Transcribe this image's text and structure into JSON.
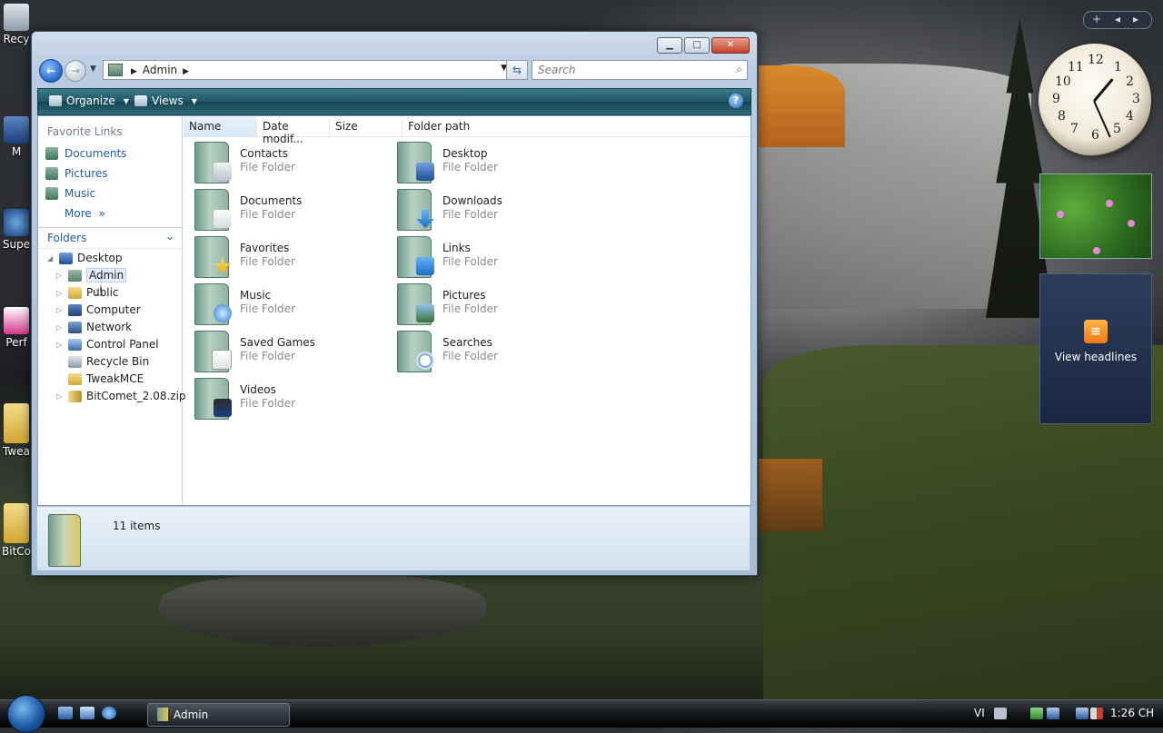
{
  "window": {
    "address_crumb": "Admin",
    "search_placeholder": "Search",
    "toolbar": {
      "organize": "Organize",
      "views": "Views"
    }
  },
  "navigation_pane": {
    "favorite_links_header": "Favorite Links",
    "favorites": [
      "Documents",
      "Pictures",
      "Music"
    ],
    "more_label": "More",
    "folders_header": "Folders",
    "tree": [
      {
        "label": "Desktop",
        "expanded": true
      },
      {
        "label": "Admin",
        "selected": true
      },
      {
        "label": "Public"
      },
      {
        "label": "Computer"
      },
      {
        "label": "Network"
      },
      {
        "label": "Control Panel"
      },
      {
        "label": "Recycle Bin"
      },
      {
        "label": "TweakMCE"
      },
      {
        "label": "BitComet_2.08.zip"
      }
    ]
  },
  "columns": [
    "Name",
    "Date modif...",
    "Size",
    "Folder path"
  ],
  "items": [
    {
      "name": "Contacts",
      "type": "File Folder",
      "icon": "contacts-folder-icon"
    },
    {
      "name": "Desktop",
      "type": "File Folder",
      "icon": "desktop-folder-icon"
    },
    {
      "name": "Documents",
      "type": "File Folder",
      "icon": "documents-folder-icon"
    },
    {
      "name": "Downloads",
      "type": "File Folder",
      "icon": "downloads-folder-icon"
    },
    {
      "name": "Favorites",
      "type": "File Folder",
      "icon": "favorites-folder-icon"
    },
    {
      "name": "Links",
      "type": "File Folder",
      "icon": "links-folder-icon"
    },
    {
      "name": "Music",
      "type": "File Folder",
      "icon": "music-folder-icon"
    },
    {
      "name": "Pictures",
      "type": "File Folder",
      "icon": "pictures-folder-icon"
    },
    {
      "name": "Saved Games",
      "type": "File Folder",
      "icon": "saved-games-folder-icon"
    },
    {
      "name": "Searches",
      "type": "File Folder",
      "icon": "searches-folder-icon"
    },
    {
      "name": "Videos",
      "type": "File Folder",
      "icon": "videos-folder-icon"
    }
  ],
  "details_pane": {
    "item_count": "11 items"
  },
  "desktop_icons": [
    "Recy",
    "M",
    "Supe",
    "Perf",
    "Twea",
    "BitCo"
  ],
  "gadgets": {
    "clock_numbers": [
      "12",
      "1",
      "2",
      "3",
      "4",
      "5",
      "6",
      "7",
      "8",
      "9",
      "10",
      "11"
    ],
    "feed_label": "View headlines"
  },
  "taskbar": {
    "task_button": "Admin",
    "language": "VI",
    "time": "1:26 CH"
  },
  "colors": {
    "accent": "#1e5aa8",
    "toolbar": "#1f5566",
    "selection": "#e3eefb"
  }
}
